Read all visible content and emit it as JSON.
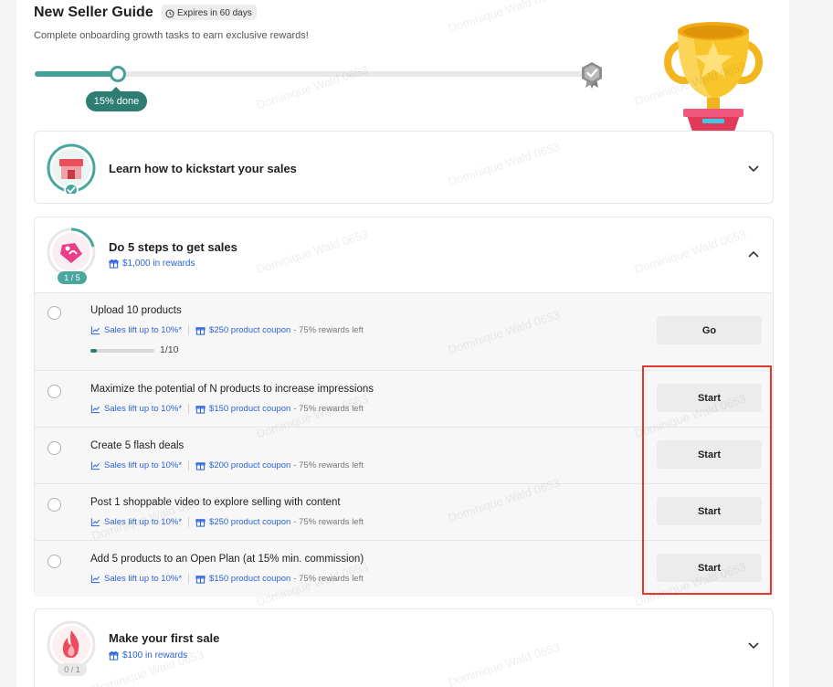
{
  "header": {
    "title": "New Seller Guide",
    "expires": "Expires in 60 days",
    "subtitle": "Complete onboarding growth tasks to earn exclusive rewards!",
    "progress_percent": 15,
    "progress_label": "15% done"
  },
  "sections": {
    "kickstart": {
      "title": "Learn how to kickstart your sales"
    },
    "five_steps": {
      "title": "Do 5 steps to get sales",
      "reward": "$1,000 in rewards",
      "count": "1 / 5",
      "tasks": [
        {
          "title": "Upload 10 products",
          "lift": "Sales lift up to 10%*",
          "coupon": "$250 product coupon",
          "left": "- 75% rewards left",
          "button": "Go",
          "progress_value": 1,
          "progress_total": 10,
          "progress_label": "1/10"
        },
        {
          "title": "Maximize the potential of N products to increase impressions",
          "lift": "Sales lift up to 10%*",
          "coupon": "$150 product coupon",
          "left": "- 75% rewards left",
          "button": "Start"
        },
        {
          "title": "Create 5 flash deals",
          "lift": "Sales lift up to 10%*",
          "coupon": "$200 product coupon",
          "left": "- 75% rewards left",
          "button": "Start"
        },
        {
          "title": "Post 1 shoppable video to explore selling with content",
          "lift": "Sales lift up to 10%*",
          "coupon": "$250 product coupon",
          "left": "- 75% rewards left",
          "button": "Start"
        },
        {
          "title": "Add 5 products to an Open Plan (at 15% min. commission)",
          "lift": "Sales lift up to 10%*",
          "coupon": "$150 product coupon",
          "left": "- 75% rewards left",
          "button": "Start"
        }
      ]
    },
    "first_sale": {
      "title": "Make your first sale",
      "reward": "$100 in rewards",
      "count": "0 / 1"
    }
  },
  "watermark": "Dominique Wald 0653",
  "colors": {
    "accent": "#2e7d72",
    "link": "#2a63d9",
    "highlight": "#e23a2e"
  },
  "icons": [
    "clock-icon",
    "medal-icon",
    "trophy-icon",
    "store-icon",
    "tag-icon",
    "flame-icon",
    "chevron-down-icon",
    "chevron-up-icon",
    "gift-icon",
    "chart-icon"
  ]
}
